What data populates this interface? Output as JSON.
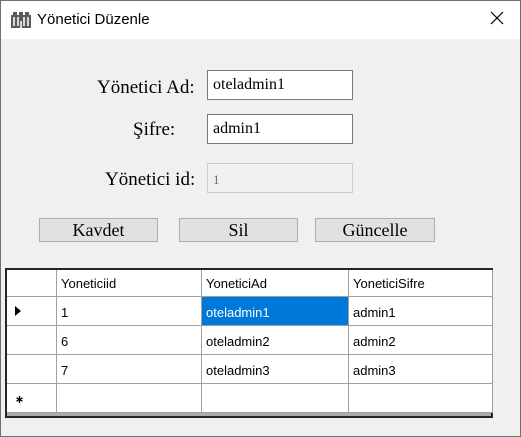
{
  "window": {
    "title": "Yönetici Düzenle",
    "icon": "building-icon",
    "close_icon": "close-icon"
  },
  "form": {
    "ad_label": "Yönetici Ad:",
    "ad_value": "oteladmin1",
    "sifre_label": "Şifre:",
    "sifre_value": "admin1",
    "id_label": "Yönetici id:",
    "id_value": "1"
  },
  "buttons": {
    "kaydet": "Kavdet",
    "sil": "Sil",
    "guncelle": "Güncelle"
  },
  "grid": {
    "columns": [
      "Yoneticiid",
      "YoneticiAd",
      "YoneticiSifre"
    ],
    "rows": [
      [
        "1",
        "oteladmin1",
        "admin1"
      ],
      [
        "6",
        "oteladmin2",
        "admin2"
      ],
      [
        "7",
        "oteladmin3",
        "admin3"
      ]
    ],
    "selected_row": 0,
    "selected_column": 1,
    "selection_color": "#0078d7",
    "current_row_icon": "row-pointer-icon",
    "new_row_icon": "new-row-asterisk-icon"
  }
}
